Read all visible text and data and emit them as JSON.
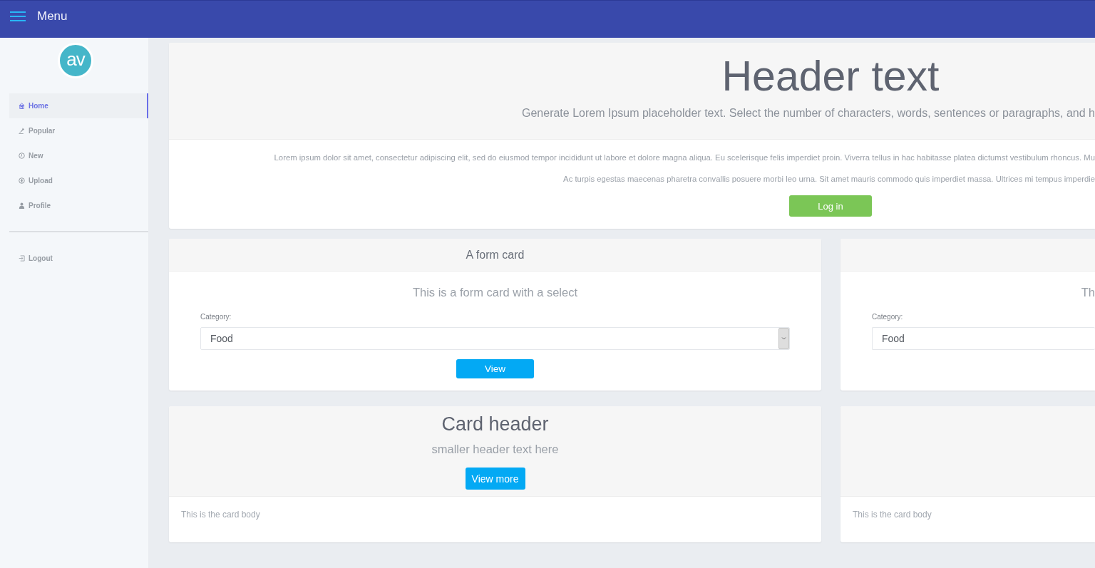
{
  "top_bar": {
    "title": "Menu"
  },
  "sidebar": {
    "avatar": "av",
    "items": [
      {
        "label": "Home",
        "selected": true
      },
      {
        "label": "Popular",
        "selected": false
      },
      {
        "label": "New",
        "selected": false
      },
      {
        "label": "Upload",
        "selected": false
      },
      {
        "label": "Profile",
        "selected": false
      }
    ],
    "footer_items": [
      {
        "label": "Logout"
      }
    ]
  },
  "hero": {
    "title": "Header text",
    "subtitle": "Generate Lorem Ipsum placeholder text. Select the number of characters, words, sentences or paragraphs, and h",
    "paragraphs": [
      "Lorem ipsum dolor sit amet, consectetur adipiscing elit, sed do eiusmod tempor incididunt ut labore et dolore magna aliqua. Eu scelerisque felis imperdiet proin. Viverra tellus in hac habitasse platea dictumst vestibulum rhoncus. Mu",
      "Ac turpis egestas maecenas pharetra convallis posuere morbi leo urna. Sit amet mauris commodo quis imperdiet massa. Ultrices mi tempus imperdie"
    ],
    "button": "Log in"
  },
  "form_cards": [
    {
      "title": "A form card",
      "subtitle": "This is a form card with a select",
      "field_label": "Category:",
      "select_value": "Food",
      "button": "View"
    },
    {
      "subtitle": "Th",
      "field_label": "Category:",
      "select_value": "Food"
    }
  ],
  "content_cards": [
    {
      "title": "Card header",
      "subtitle": "smaller header text here",
      "button": "View more",
      "body": "This is the card body"
    },
    {
      "body": "This is the card body"
    }
  ]
}
